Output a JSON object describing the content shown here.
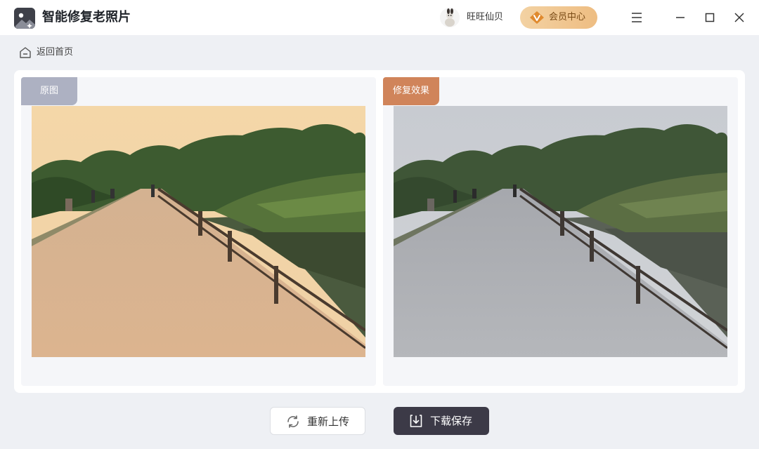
{
  "app": {
    "title": "智能修复老照片",
    "icon": "photo-restore-app-icon"
  },
  "header": {
    "user": {
      "avatar_icon": "user-avatar",
      "name": "旺旺仙贝"
    },
    "vip": {
      "icon": "vip-v-badge-icon",
      "label": "会员中心"
    },
    "window_controls": [
      "menu-icon",
      "minimize-icon",
      "maximize-icon",
      "close-icon"
    ]
  },
  "breadcrumb": {
    "icon": "home-icon",
    "back_label": "返回首页"
  },
  "compare": {
    "original": {
      "tag": "原图",
      "image": "old photo of a concrete bridge with railing over a river, warm sepia tint"
    },
    "restored": {
      "tag": "修复效果",
      "image": "restored photo of the same bridge with natural colors"
    }
  },
  "actions": {
    "reupload": {
      "icon": "refresh-icon",
      "label": "重新上传"
    },
    "download": {
      "icon": "download-icon",
      "label": "下载保存"
    }
  },
  "colors": {
    "original_tag": "#adb1c2",
    "restored_tag": "#d0845a",
    "vip_gradient_start": "#f3d2a3",
    "vip_gradient_end": "#eebd82",
    "download_button": "#3c3a47"
  }
}
